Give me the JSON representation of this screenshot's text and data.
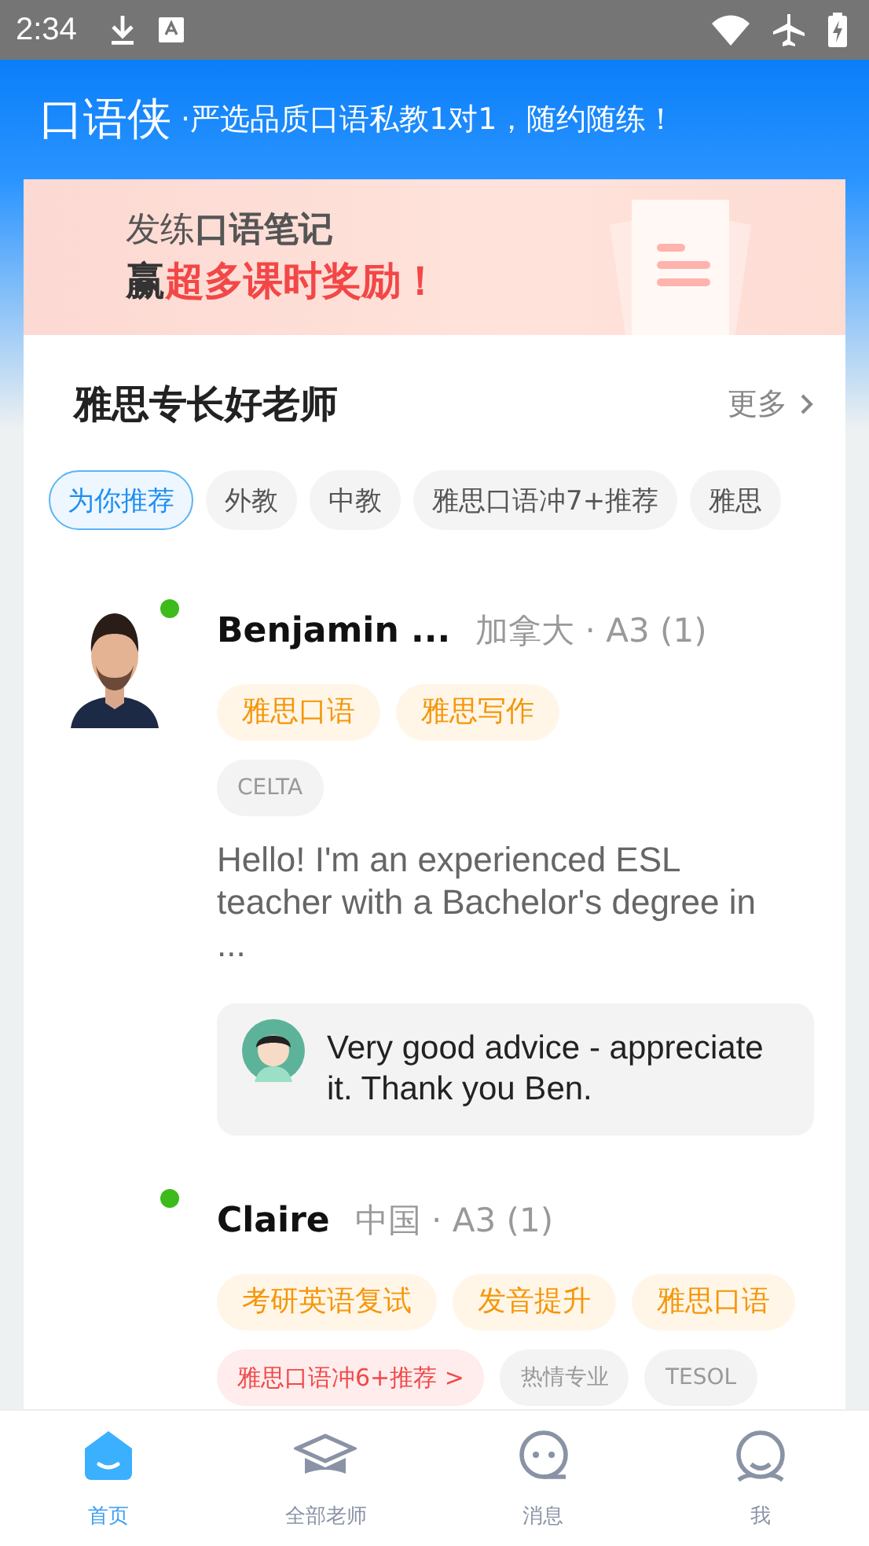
{
  "status_bar": {
    "time": "2:34"
  },
  "header": {
    "logo": "口语侠",
    "slogan": "·严选品质口语私教1对1，随约随练！"
  },
  "banner": {
    "line_1": "发练**口语笔记**",
    "line_2": {
      "lead": "赢",
      "highlight": "超多课时奖励！"
    }
  },
  "section": {
    "title": "雅思专长好老师",
    "more": "更多"
  },
  "filters": [
    {
      "label": "为你推荐",
      "selected": true
    },
    {
      "label": "外教",
      "selected": false
    },
    {
      "label": "中教",
      "selected": false
    },
    {
      "label": "雅思口语冲7+推荐",
      "selected": false
    },
    {
      "label": "雅思",
      "selected": false
    }
  ],
  "teachers": [
    {
      "name": "Benjamin ...",
      "meta": "加拿大 · A3 (1)",
      "online": true,
      "avatar": {
        "kind": "picture"
      },
      "tags": [
        {
          "label": "雅思口语",
          "kind": "specialty"
        },
        {
          "label": "雅思写作",
          "kind": "specialty"
        },
        {
          "label": "CELTA",
          "kind": "plain"
        }
      ],
      "intro": "Hello! I'm an experienced ESL teacher with a Bachelor's degree in ...",
      "review": "Very good advice - appreciate it. Thank you Ben."
    },
    {
      "name": "Claire",
      "meta": "中国 · A3 (1)",
      "online": true,
      "tags": [
        {
          "label": "考研英语复试",
          "kind": "specialty"
        },
        {
          "label": "发音提升",
          "kind": "specialty"
        },
        {
          "label": "雅思口语",
          "kind": "specialty"
        },
        {
          "label": "雅思口语冲6+推荐 >",
          "kind": "promo"
        },
        {
          "label": "热情专业",
          "kind": "plain"
        },
        {
          "label": "TESOL",
          "kind": "plain"
        }
      ]
    }
  ],
  "bottom_nav": [
    {
      "label": "首页",
      "kind": "home",
      "selected": true
    },
    {
      "label": "全部老师",
      "kind": "teachers",
      "selected": false
    },
    {
      "label": "消息",
      "kind": "messages",
      "selected": false
    },
    {
      "label": "我",
      "kind": "me",
      "selected": false
    }
  ]
}
